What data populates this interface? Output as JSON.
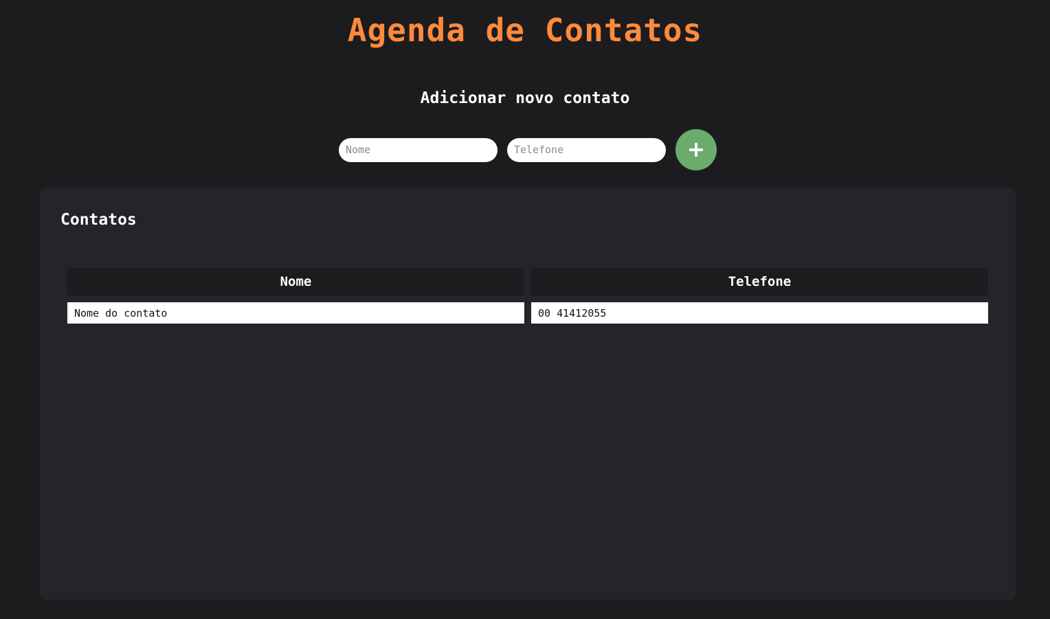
{
  "app": {
    "title": "Agenda de Contatos"
  },
  "form": {
    "heading": "Adicionar novo contato",
    "name_placeholder": "Nome",
    "phone_placeholder": "Telefone",
    "add_button_icon": "plus-icon"
  },
  "contacts": {
    "title": "Contatos",
    "columns": [
      "Nome",
      "Telefone"
    ],
    "rows": [
      {
        "name": "Nome do contato",
        "phone": "00 41412055"
      }
    ]
  },
  "colors": {
    "background": "#1c1c1e",
    "panel": "#242429",
    "accent_title": "#ff8a3d",
    "add_button": "#6aac6c"
  }
}
